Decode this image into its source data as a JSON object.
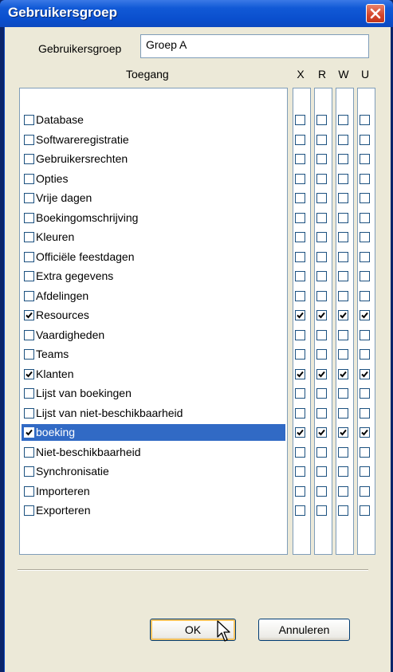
{
  "window": {
    "title": "Gebruikersgroep"
  },
  "group": {
    "label": "Gebruikersgroep",
    "value": "Groep A"
  },
  "table": {
    "access_header": "Toegang",
    "columns": [
      "X",
      "R",
      "W",
      "U"
    ],
    "rows": [
      {
        "label": "Database",
        "checked": false,
        "perms": [
          false,
          false,
          false,
          false
        ]
      },
      {
        "label": "Softwareregistratie",
        "checked": false,
        "perms": [
          false,
          false,
          false,
          false
        ]
      },
      {
        "label": "Gebruikersrechten",
        "checked": false,
        "perms": [
          false,
          false,
          false,
          false
        ]
      },
      {
        "label": "Opties",
        "checked": false,
        "perms": [
          false,
          false,
          false,
          false
        ]
      },
      {
        "label": "Vrije dagen",
        "checked": false,
        "perms": [
          false,
          false,
          false,
          false
        ]
      },
      {
        "label": "Boekingomschrijving",
        "checked": false,
        "perms": [
          false,
          false,
          false,
          false
        ]
      },
      {
        "label": "Kleuren",
        "checked": false,
        "perms": [
          false,
          false,
          false,
          false
        ]
      },
      {
        "label": "Officiële feestdagen",
        "checked": false,
        "perms": [
          false,
          false,
          false,
          false
        ]
      },
      {
        "label": "Extra gegevens",
        "checked": false,
        "perms": [
          false,
          false,
          false,
          false
        ]
      },
      {
        "label": "Afdelingen",
        "checked": false,
        "perms": [
          false,
          false,
          false,
          false
        ]
      },
      {
        "label": "Resources",
        "checked": true,
        "perms": [
          true,
          true,
          true,
          true
        ]
      },
      {
        "label": "Vaardigheden",
        "checked": false,
        "perms": [
          false,
          false,
          false,
          false
        ]
      },
      {
        "label": "Teams",
        "checked": false,
        "perms": [
          false,
          false,
          false,
          false
        ]
      },
      {
        "label": "Klanten",
        "checked": true,
        "perms": [
          true,
          true,
          true,
          true
        ]
      },
      {
        "label": "Lijst van boekingen",
        "checked": false,
        "perms": [
          false,
          false,
          false,
          false
        ]
      },
      {
        "label": "Lijst van niet-beschikbaarheid",
        "checked": false,
        "perms": [
          false,
          false,
          false,
          false
        ]
      },
      {
        "label": "boeking",
        "checked": true,
        "selected": true,
        "perms": [
          true,
          true,
          true,
          true
        ]
      },
      {
        "label": "Niet-beschikbaarheid",
        "checked": false,
        "perms": [
          false,
          false,
          false,
          false
        ]
      },
      {
        "label": "Synchronisatie",
        "checked": false,
        "perms": [
          false,
          false,
          false,
          false
        ]
      },
      {
        "label": "Importeren",
        "checked": false,
        "perms": [
          false,
          false,
          false,
          false
        ]
      },
      {
        "label": "Exporteren",
        "checked": false,
        "perms": [
          false,
          false,
          false,
          false
        ]
      }
    ]
  },
  "buttons": {
    "ok": "OK",
    "cancel": "Annuleren"
  },
  "icons": {
    "close": "close-icon",
    "cursor": "mouse-cursor-icon"
  },
  "colors": {
    "titlebar": "#0a4fce",
    "selection": "#316ac5",
    "close": "#d4452a"
  }
}
